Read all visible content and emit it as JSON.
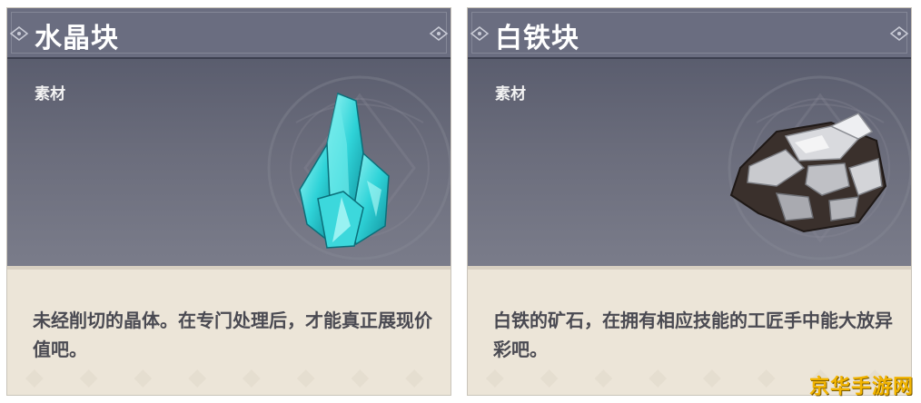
{
  "cards": [
    {
      "title": "水晶块",
      "category": "素材",
      "description": "未经削切的晶体。在专门处理后，才能真正展现价值吧。",
      "icon": "crystal-chunk-icon"
    },
    {
      "title": "白铁块",
      "category": "素材",
      "description": "白铁的矿石，在拥有相应技能的工匠手中能大放异彩吧。",
      "icon": "white-iron-chunk-icon"
    }
  ],
  "watermark": "京华手游网",
  "colors": {
    "header_bg": "#6a6d80",
    "art_bg": "#6b6d7c",
    "desc_bg": "#ece5d8",
    "crystal": "#2fd3d8",
    "watermark": "#f2b400"
  }
}
